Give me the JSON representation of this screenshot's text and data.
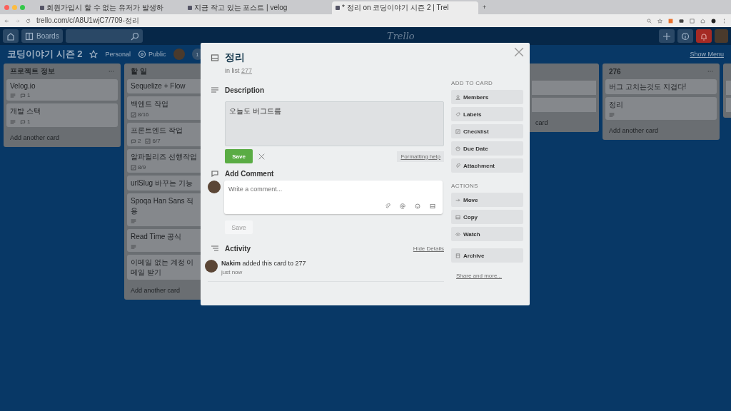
{
  "browser": {
    "tabs": [
      {
        "title": "회원가입시 할 수 없는 유저가 발생하",
        "selected": false
      },
      {
        "title": "지금 작고 있는 포스트 | velog",
        "selected": false
      },
      {
        "title": "* 정리 on 코딩이야기 시즌 2 | Trel",
        "selected": true
      }
    ],
    "new_tab": "+",
    "url": "trello.com/c/A8U1wjC7/709-정리"
  },
  "header": {
    "boards_button": "Boards",
    "logo": "Trello"
  },
  "board": {
    "title": "코딩이야기 시즌 2",
    "team": "Personal",
    "visibility": "Public",
    "member_count": "1",
    "show_menu": "Show Menu"
  },
  "lists": [
    {
      "kind": "full",
      "title": "프로젝트 정보",
      "cards": [
        {
          "title": "Velog.io",
          "badges": [
            {
              "kind": "description"
            },
            {
              "kind": "comments",
              "text": "1"
            }
          ]
        },
        {
          "title": "개발 스택",
          "badges": [
            {
              "kind": "description"
            },
            {
              "kind": "comments",
              "text": "1"
            }
          ]
        }
      ],
      "add_card": "Add another card"
    },
    {
      "kind": "full",
      "title": "할 일",
      "cards": [
        {
          "title": "Sequelize + Flow"
        },
        {
          "title": "백엔드 작업",
          "badges": [
            {
              "kind": "checklist",
              "text": "8/16"
            }
          ]
        },
        {
          "title": "프론트엔드 작업",
          "badges": [
            {
              "kind": "comments",
              "text": "2"
            },
            {
              "kind": "checklist",
              "text": "6/7"
            }
          ]
        },
        {
          "title": "알파릴리즈 선행작업",
          "badges": [
            {
              "kind": "checklist",
              "text": "8/9"
            }
          ]
        },
        {
          "title": "urlSlug 바꾸는 기능"
        },
        {
          "title": "Spoqa Han Sans 적용",
          "badges": [
            {
              "kind": "description"
            }
          ]
        },
        {
          "title": "Read Time 공식",
          "badges": [
            {
              "kind": "description"
            }
          ]
        },
        {
          "title": "이메일 없는 계정 이메일 받기"
        }
      ],
      "add_card": "Add another card"
    },
    {
      "kind": "fragment",
      "add_card": "card"
    },
    {
      "kind": "full",
      "title": "276",
      "cards": [
        {
          "title": "버그 고치는것도 지겹다!"
        },
        {
          "title": "정리",
          "badges": [
            {
              "kind": "description"
            }
          ]
        }
      ],
      "add_card": "Add another card"
    },
    {
      "kind": "edge"
    }
  ],
  "card_modal": {
    "title": "정리",
    "list_prefix": "in list",
    "list_link": "277",
    "description_heading": "Description",
    "description_text": "오늘도 버그드름",
    "save_button": "Save",
    "formatting_help": "Formatting help",
    "comment_heading": "Add Comment",
    "comment_field": {
      "placeholder": "Write a comment..."
    },
    "comment_save": {
      "label": "Save",
      "disabled": true
    },
    "activity_heading": "Activity",
    "hide_details": "Hide Details",
    "activity": [
      {
        "text": "**Nakim** added this card to 277",
        "time": "just now"
      }
    ],
    "add_to_card_heading": "ADD TO CARD",
    "add_to_card": [
      {
        "kind": "members",
        "label": "Members"
      },
      {
        "kind": "labels",
        "label": "Labels"
      },
      {
        "kind": "checklist",
        "label": "Checklist"
      },
      {
        "kind": "due",
        "label": "Due Date"
      },
      {
        "kind": "attachment",
        "label": "Attachment"
      }
    ],
    "actions_heading": "ACTIONS",
    "actions": [
      {
        "kind": "move",
        "label": "Move"
      },
      {
        "kind": "copy",
        "label": "Copy"
      },
      {
        "kind": "watch",
        "label": "Watch"
      },
      {
        "kind": "archive",
        "label": "Archive"
      }
    ],
    "share": "Share and more..."
  }
}
